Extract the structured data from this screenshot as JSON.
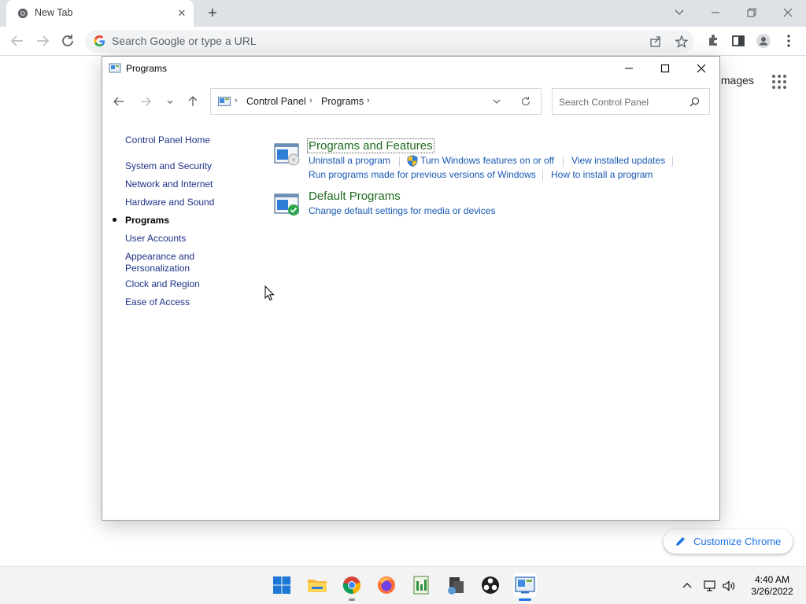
{
  "chrome": {
    "tab_title": "New Tab",
    "omnibox_placeholder": "Search Google or type a URL",
    "ntp_images_link": "Images",
    "customize_label": "Customize Chrome"
  },
  "control_panel": {
    "window_title": "Programs",
    "breadcrumb": [
      "Control Panel",
      "Programs"
    ],
    "search_placeholder": "Search Control Panel",
    "sidebar": [
      "Control Panel Home",
      "System and Security",
      "Network and Internet",
      "Hardware and Sound",
      "Programs",
      "User Accounts",
      "Appearance and",
      "Personalization",
      "Clock and Region",
      "Ease of Access"
    ],
    "active_sidebar_item": "Programs",
    "categories": [
      {
        "title": "Programs and Features",
        "links": [
          "Uninstall a program",
          "Turn Windows features on or off",
          "View installed updates",
          "Run programs made for previous versions of Windows",
          "How to install a program"
        ]
      },
      {
        "title": "Default Programs",
        "links": [
          "Change default settings for media or devices"
        ]
      }
    ]
  },
  "taskbar": {
    "time": "4:40 AM",
    "date": "3/26/2022",
    "apps": [
      "start-icon",
      "file-explorer-icon",
      "chrome-icon",
      "firefox-icon",
      "notepad-icon",
      "app-icon",
      "obs-icon",
      "control-panel-icon"
    ]
  },
  "colors": {
    "link": "#1757b3",
    "category_title": "#1e6b1e",
    "chrome_accent": "#1a73e8"
  }
}
